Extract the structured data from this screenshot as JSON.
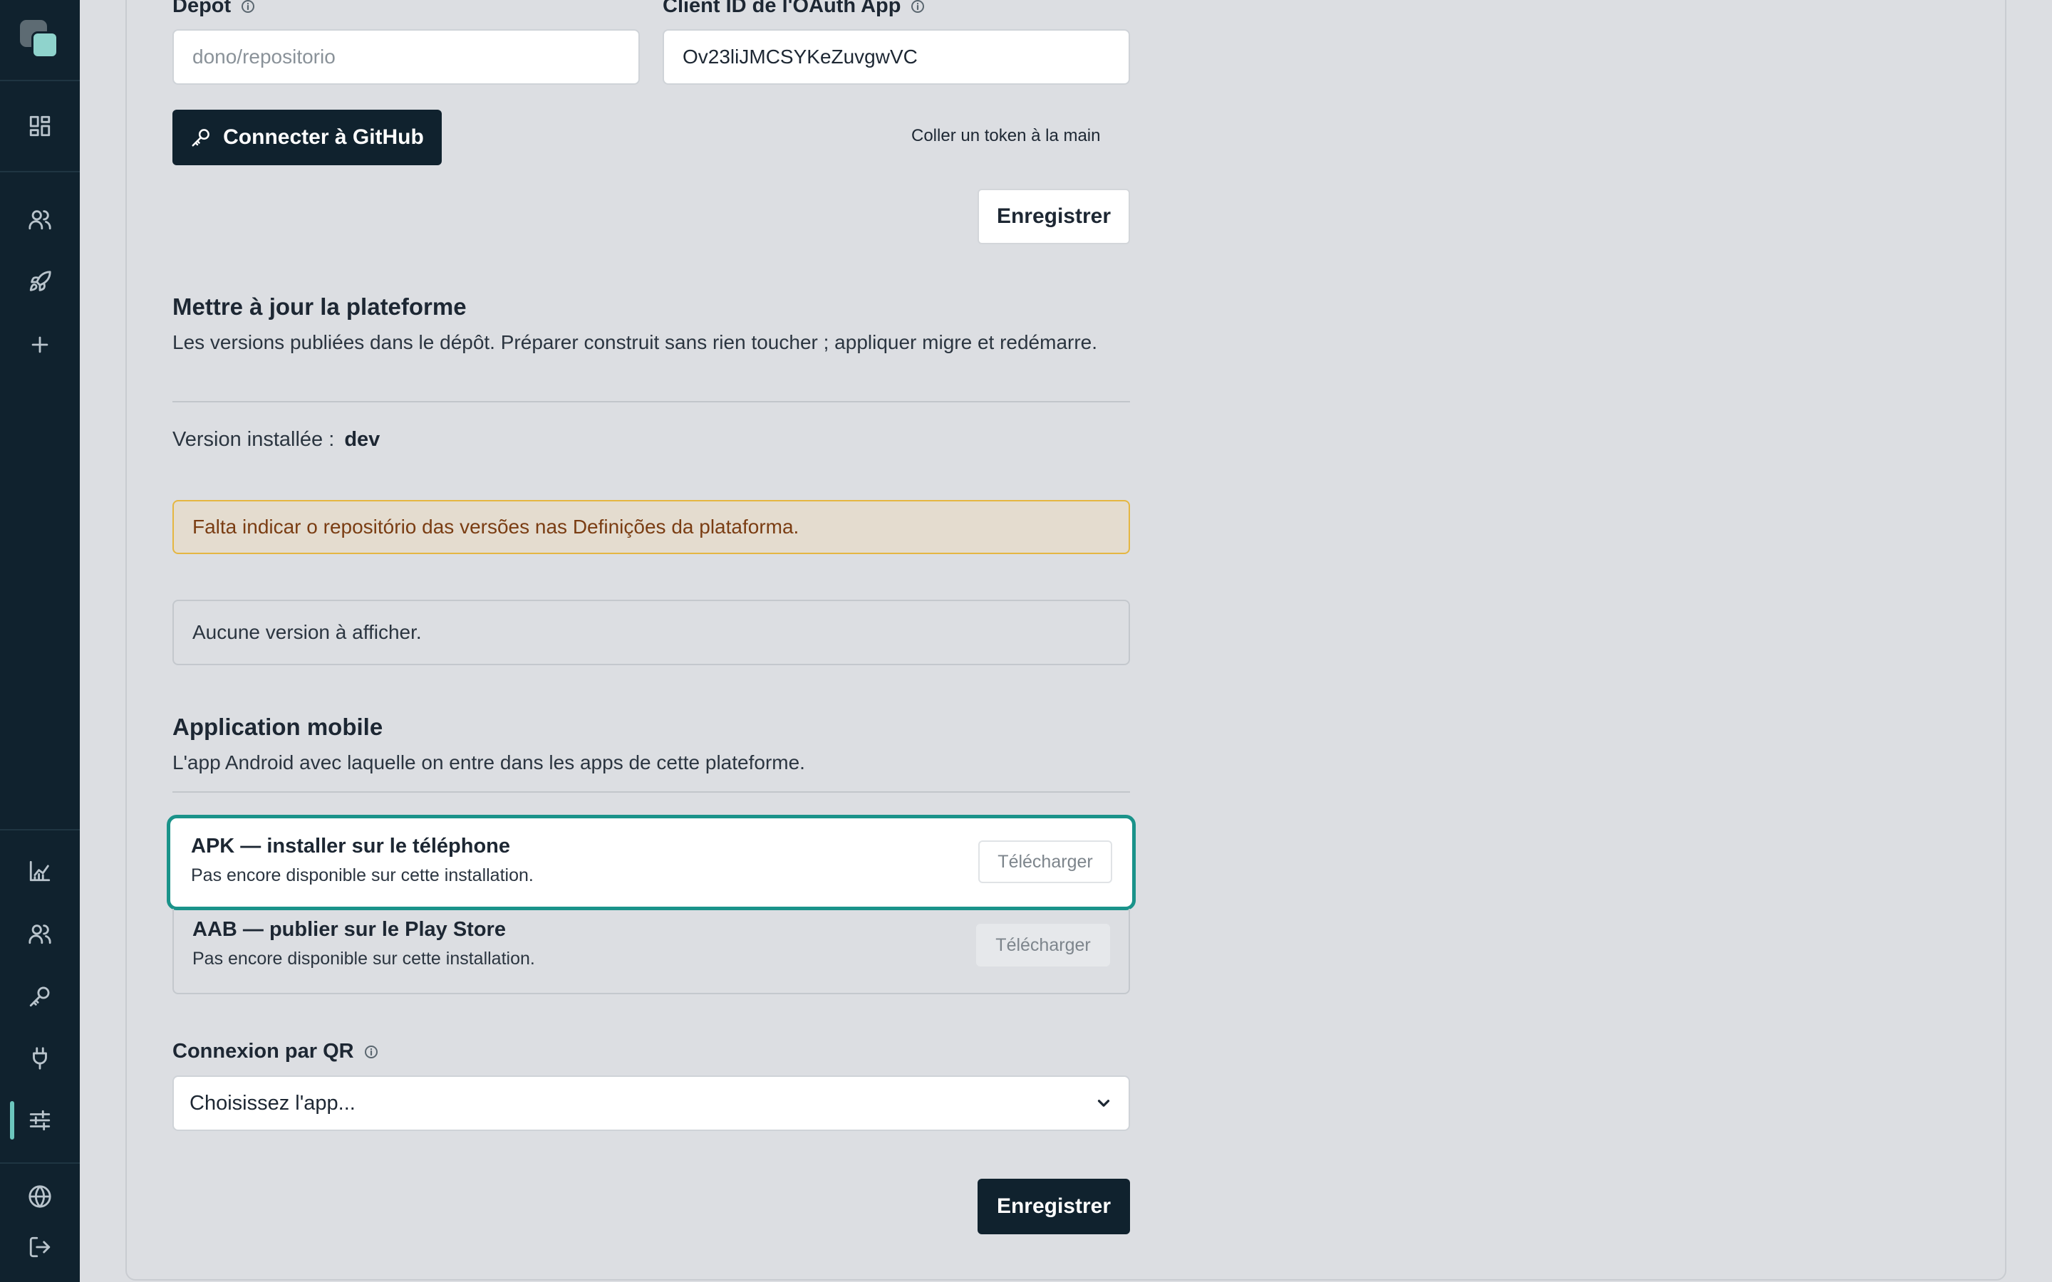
{
  "sidebar": {
    "top_icons": [
      "dashboard-icon",
      "users-icon",
      "rocket-icon",
      "plus-icon"
    ],
    "bottom_icons": [
      "chart-icon",
      "team-icon",
      "key-icon",
      "plug-icon",
      "sliders-icon",
      "globe-icon",
      "logout-icon"
    ],
    "active_item": "sliders-icon"
  },
  "repo": {
    "depot_label": "Depot",
    "depot_placeholder": "dono/repositorio",
    "client_id_label": "Client ID de l'OAuth App",
    "client_id_value": "Ov23liJMCSYKeZuvgwVC",
    "connect_button": "Connecter à GitHub",
    "paste_token_link": "Coller un token à la main",
    "save_button": "Enregistrer"
  },
  "update": {
    "title": "Mettre à jour la plateforme",
    "description": "Les versions publiées dans le dépôt. Préparer construit sans rien toucher ; appliquer migre et redémarre.",
    "installed_label": "Version installée :",
    "installed_value": "dev",
    "warning": "Falta indicar o repositório das versões nas Definições da plataforma.",
    "empty": "Aucune version à afficher."
  },
  "mobile": {
    "title": "Application mobile",
    "description": "L'app Android avec laquelle on entre dans les apps de cette plateforme.",
    "apk_title": "APK — installer sur le téléphone",
    "apk_sub": "Pas encore disponible sur cette installation.",
    "apk_button": "Télécharger",
    "aab_title": "AAB — publier sur le Play Store",
    "aab_sub": "Pas encore disponible sur cette installation.",
    "aab_button": "Télécharger",
    "qr_label": "Connexion par QR",
    "qr_select": "Choisissez l'app...",
    "save_button": "Enregistrer"
  },
  "colors": {
    "sidebar_bg": "#10222e",
    "accent": "#1a938a",
    "warning_border": "#e5b641",
    "warning_text": "#7a3d13"
  }
}
